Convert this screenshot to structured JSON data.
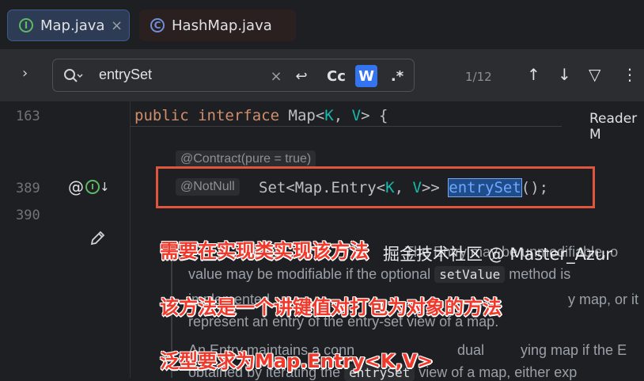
{
  "tabs": [
    {
      "label": "Map.java",
      "icon": "interface-icon",
      "active": true,
      "close": "×"
    },
    {
      "label": "HashMap.java",
      "icon": "class-icon",
      "active": false
    }
  ],
  "findbar": {
    "expand_glyph": "›",
    "query": "entrySet",
    "clear_glyph": "×",
    "newline_glyph": "↩",
    "case_label": "Cc",
    "word_label": "W",
    "regex_label": ".*",
    "match_count": "1/12",
    "prev_glyph": "↑",
    "next_glyph": "↓",
    "filter_glyph": "▽",
    "more_glyph": "⋮"
  },
  "editor": {
    "reader_mode": "Reader M",
    "line_163": "163",
    "line_389": "389",
    "line_390": "390",
    "decl_public": "public",
    "decl_interface": "interface",
    "decl_map": "Map<",
    "decl_k": "K",
    "decl_comma": ", ",
    "decl_v": "V",
    "decl_end": "> {",
    "inlay_contract": "@Contract(pure = true)",
    "inlay_notnull": "@NotNull",
    "code_set": "Set<Map.Entry<",
    "code_k": "K",
    "code_comma": ", ",
    "code_v": "V",
    "code_close": ">> ",
    "code_highlight": "entrySet",
    "code_tail": "();",
    "gutter_at": "@",
    "gutter_i": "I",
    "gutter_arrow": "↓",
    "doc_line1": "The Entry may be unmodifiable, o",
    "doc_line2_a": "value may be modifiable if the optional ",
    "doc_line2_code": "setValue",
    "doc_line2_b": " method is",
    "doc_line3_a": "implemented",
    "doc_line3_b": "y map, or it",
    "doc_line4": "represent an entry of the entry-set view of a map.",
    "doc_line5_a": "An Entry maintains a conn",
    "doc_line5_b": "dual",
    "doc_line5_c": "ying map if the E",
    "doc_line6_a": "obtained by iterating the ",
    "doc_line6_code": "entrySet",
    "doc_line6_b": " view of a map, either exp"
  },
  "annotations": {
    "note1": "需要在实现类实现该方法",
    "note2": "该方法是一个讲键值对打包为对象的方法",
    "note3": "泛型要求为Map.Entry<K,V>",
    "watermark": "掘金技术社区 @ Master_Azur"
  },
  "colors": {
    "accent": "#3574f0",
    "annotation": "#f0392b",
    "box": "#e0553d"
  }
}
